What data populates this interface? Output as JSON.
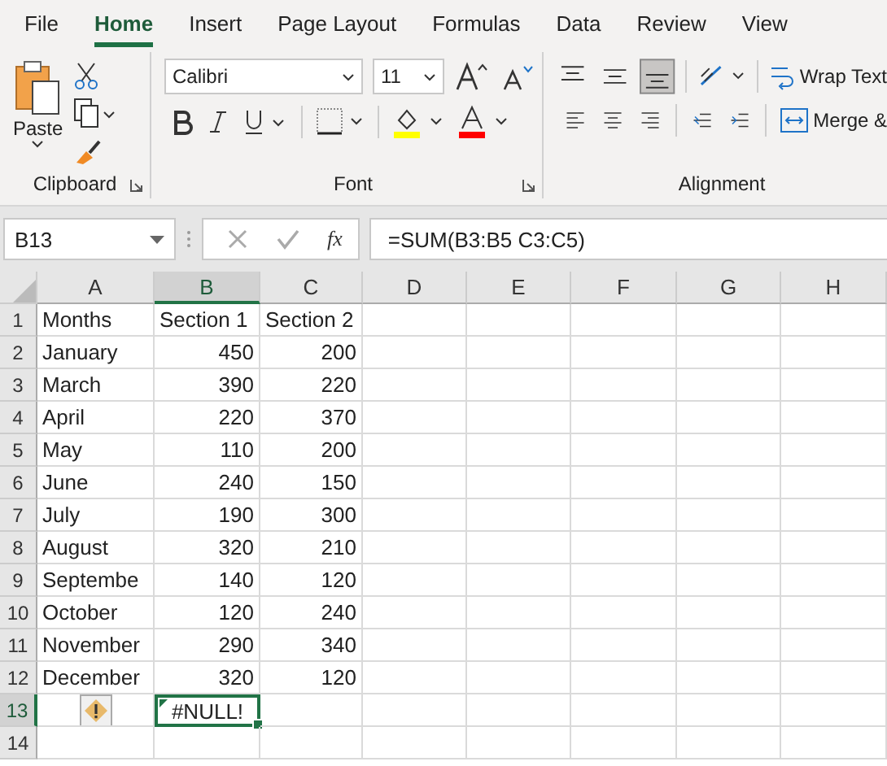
{
  "menu_tabs": [
    {
      "label": "File",
      "selected": false
    },
    {
      "label": "Home",
      "selected": true
    },
    {
      "label": "Insert",
      "selected": false
    },
    {
      "label": "Page Layout",
      "selected": false
    },
    {
      "label": "Formulas",
      "selected": false
    },
    {
      "label": "Data",
      "selected": false
    },
    {
      "label": "Review",
      "selected": false
    },
    {
      "label": "View",
      "selected": false
    }
  ],
  "ribbon": {
    "clipboard": {
      "paste_label": "Paste",
      "group_label": "Clipboard"
    },
    "font": {
      "font_name": "Calibri",
      "font_size": "11",
      "group_label": "Font"
    },
    "alignment": {
      "wrap_text": "Wrap Text",
      "merge": "Merge &",
      "group_label": "Alignment"
    }
  },
  "formula_bar": {
    "name_box": "B13",
    "function_label": "fx",
    "formula": "=SUM(B3:B5 C3:C5)"
  },
  "columns": [
    {
      "label": "A",
      "selected": false
    },
    {
      "label": "B",
      "selected": true
    },
    {
      "label": "C",
      "selected": false
    },
    {
      "label": "D",
      "selected": false
    },
    {
      "label": "E",
      "selected": false
    },
    {
      "label": "F",
      "selected": false
    },
    {
      "label": "G",
      "selected": false
    },
    {
      "label": "H",
      "selected": false
    }
  ],
  "rows": [
    {
      "number": "1",
      "selected": false,
      "cells": [
        {
          "text": "Months",
          "kind": "text"
        },
        {
          "text": "Section 1",
          "kind": "text"
        },
        {
          "text": "Section 2",
          "kind": "text"
        }
      ]
    },
    {
      "number": "2",
      "selected": false,
      "cells": [
        {
          "text": "January",
          "kind": "text"
        },
        {
          "text": "450",
          "kind": "number"
        },
        {
          "text": "200",
          "kind": "number"
        }
      ]
    },
    {
      "number": "3",
      "selected": false,
      "cells": [
        {
          "text": "March",
          "kind": "text"
        },
        {
          "text": "390",
          "kind": "number"
        },
        {
          "text": "220",
          "kind": "number"
        }
      ]
    },
    {
      "number": "4",
      "selected": false,
      "cells": [
        {
          "text": "April",
          "kind": "text"
        },
        {
          "text": "220",
          "kind": "number"
        },
        {
          "text": "370",
          "kind": "number"
        }
      ]
    },
    {
      "number": "5",
      "selected": false,
      "cells": [
        {
          "text": "May",
          "kind": "text"
        },
        {
          "text": "110",
          "kind": "number"
        },
        {
          "text": "200",
          "kind": "number"
        }
      ]
    },
    {
      "number": "6",
      "selected": false,
      "cells": [
        {
          "text": "June",
          "kind": "text"
        },
        {
          "text": "240",
          "kind": "number"
        },
        {
          "text": "150",
          "kind": "number"
        }
      ]
    },
    {
      "number": "7",
      "selected": false,
      "cells": [
        {
          "text": "July",
          "kind": "text"
        },
        {
          "text": "190",
          "kind": "number"
        },
        {
          "text": "300",
          "kind": "number"
        }
      ]
    },
    {
      "number": "8",
      "selected": false,
      "cells": [
        {
          "text": "August",
          "kind": "text"
        },
        {
          "text": "320",
          "kind": "number"
        },
        {
          "text": "210",
          "kind": "number"
        }
      ]
    },
    {
      "number": "9",
      "selected": false,
      "cells": [
        {
          "text": "Septembe",
          "kind": "text"
        },
        {
          "text": "140",
          "kind": "number"
        },
        {
          "text": "120",
          "kind": "number"
        }
      ]
    },
    {
      "number": "10",
      "selected": false,
      "cells": [
        {
          "text": "October",
          "kind": "text"
        },
        {
          "text": "120",
          "kind": "number"
        },
        {
          "text": "240",
          "kind": "number"
        }
      ]
    },
    {
      "number": "11",
      "selected": false,
      "cells": [
        {
          "text": "November",
          "kind": "text"
        },
        {
          "text": "290",
          "kind": "number"
        },
        {
          "text": "340",
          "kind": "number"
        }
      ]
    },
    {
      "number": "12",
      "selected": false,
      "cells": [
        {
          "text": "December",
          "kind": "text"
        },
        {
          "text": "320",
          "kind": "number"
        },
        {
          "text": "120",
          "kind": "number"
        }
      ]
    },
    {
      "number": "13",
      "selected": true,
      "cells": [
        {
          "kind": "warning"
        },
        {
          "text": "#NULL!",
          "kind": "error",
          "selected": true
        }
      ]
    },
    {
      "number": "14",
      "selected": false,
      "cells": []
    }
  ]
}
